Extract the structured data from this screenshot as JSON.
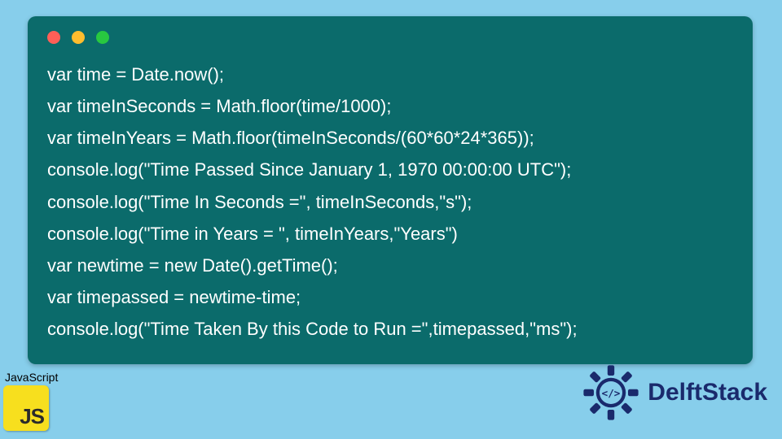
{
  "code": {
    "lines": [
      "var time = Date.now();",
      "var timeInSeconds = Math.floor(time/1000);",
      "var timeInYears = Math.floor(timeInSeconds/(60*60*24*365));",
      "console.log(\"Time Passed Since January 1, 1970 00:00:00 UTC\");",
      "console.log(\"Time In Seconds =\", timeInSeconds,\"s\");",
      "console.log(\"Time in Years = \", timeInYears,\"Years\")",
      "var newtime = new Date().getTime();",
      "var timepassed = newtime-time;",
      "console.log(\"Time Taken By this Code to Run =\",timepassed,\"ms\");"
    ]
  },
  "badges": {
    "js_label": "JavaScript",
    "js_icon_text": "JS",
    "delft_text": "DelftStack"
  },
  "colors": {
    "page_bg": "#87ceeb",
    "card_bg": "#0b6b6b",
    "code_fg": "#ffffff",
    "js_bg": "#f7df1e",
    "delft_primary": "#1a2a6c"
  }
}
